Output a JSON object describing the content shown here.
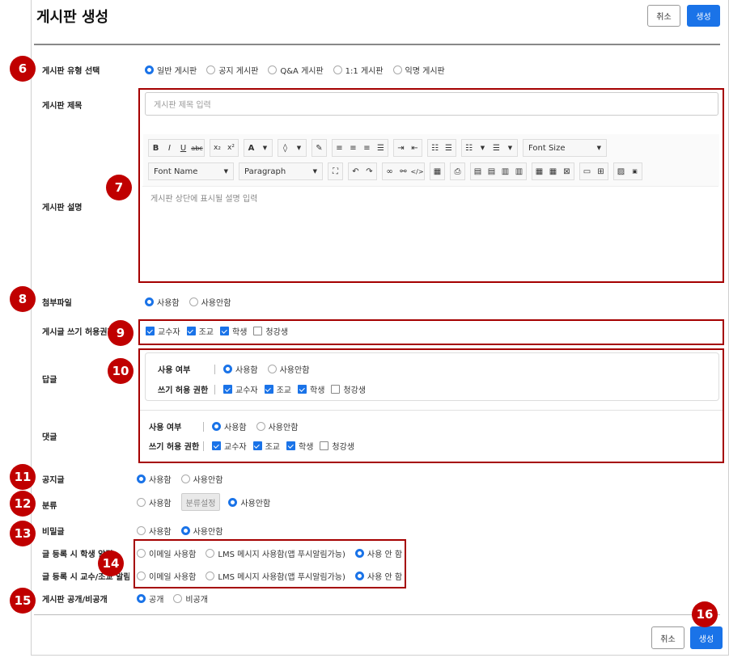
{
  "page": {
    "title": "게시판 생성"
  },
  "header": {
    "cancel_label": "취소",
    "create_label": "생성"
  },
  "footer": {
    "cancel_label": "취소",
    "create_label": "생성"
  },
  "badges": [
    "6",
    "7",
    "8",
    "9",
    "10",
    "11",
    "12",
    "13",
    "14",
    "15",
    "16"
  ],
  "board_type": {
    "label": "게시판 유형 선택",
    "options": [
      "일반 게시판",
      "공지 게시판",
      "Q&A 게시판",
      "1:1 게시판",
      "익명 게시판"
    ],
    "selected": "일반 게시판"
  },
  "board_title": {
    "label": "게시판 제목",
    "placeholder": "게시판 제목 입력"
  },
  "board_desc": {
    "label": "게시판 설명",
    "placeholder": "게시판 상단에 표시될 설명 입력"
  },
  "editor": {
    "font_size_label": "Font Size",
    "font_name_label": "Font Name",
    "paragraph_label": "Paragraph"
  },
  "attachment": {
    "label": "첨부파일",
    "options": [
      "사용함",
      "사용안함"
    ],
    "selected": "사용함"
  },
  "write_perm": {
    "label": "게시글 쓰기 허용권한",
    "options": [
      "교수자",
      "조교",
      "학생",
      "청강생"
    ],
    "checked": [
      "교수자",
      "조교",
      "학생"
    ]
  },
  "reply": {
    "label": "답글",
    "use_label": "사용 여부",
    "use_options": [
      "사용함",
      "사용안함"
    ],
    "perm_label": "쓰기 허용 권한",
    "perm_options": [
      "교수자",
      "조교",
      "학생",
      "청강생"
    ]
  },
  "comment": {
    "label": "댓글",
    "use_label": "사용 여부",
    "use_options": [
      "사용함",
      "사용안함"
    ],
    "perm_label": "쓰기 허용 권한",
    "perm_options": [
      "교수자",
      "조교",
      "학생",
      "청강생"
    ]
  },
  "notice": {
    "label": "공지글",
    "options": [
      "사용함",
      "사용안함"
    ]
  },
  "category": {
    "label": "분류",
    "opt_use": "사용함",
    "settings_btn": "분류설정",
    "opt_nouse": "사용안함"
  },
  "secret": {
    "label": "비밀글",
    "options": [
      "사용함",
      "사용안함"
    ]
  },
  "student_alarm": {
    "label": "글 등록 시 학생 알림",
    "options": [
      "이메일 사용함",
      "LMS 메시지 사용함(앱 푸시알림가능)",
      "사용 안 함"
    ]
  },
  "prof_alarm": {
    "label": "글 등록 시 교수/조교 알림",
    "options": [
      "이메일 사용함",
      "LMS 메시지 사용함(앱 푸시알림가능)",
      "사용 안 함"
    ]
  },
  "visibility": {
    "label": "게시판 공개/비공개",
    "options": [
      "공개",
      "비공개"
    ]
  },
  "colors": {
    "accent": "#1a73e8",
    "highlight": "#a50000",
    "badge": "#c00000"
  }
}
